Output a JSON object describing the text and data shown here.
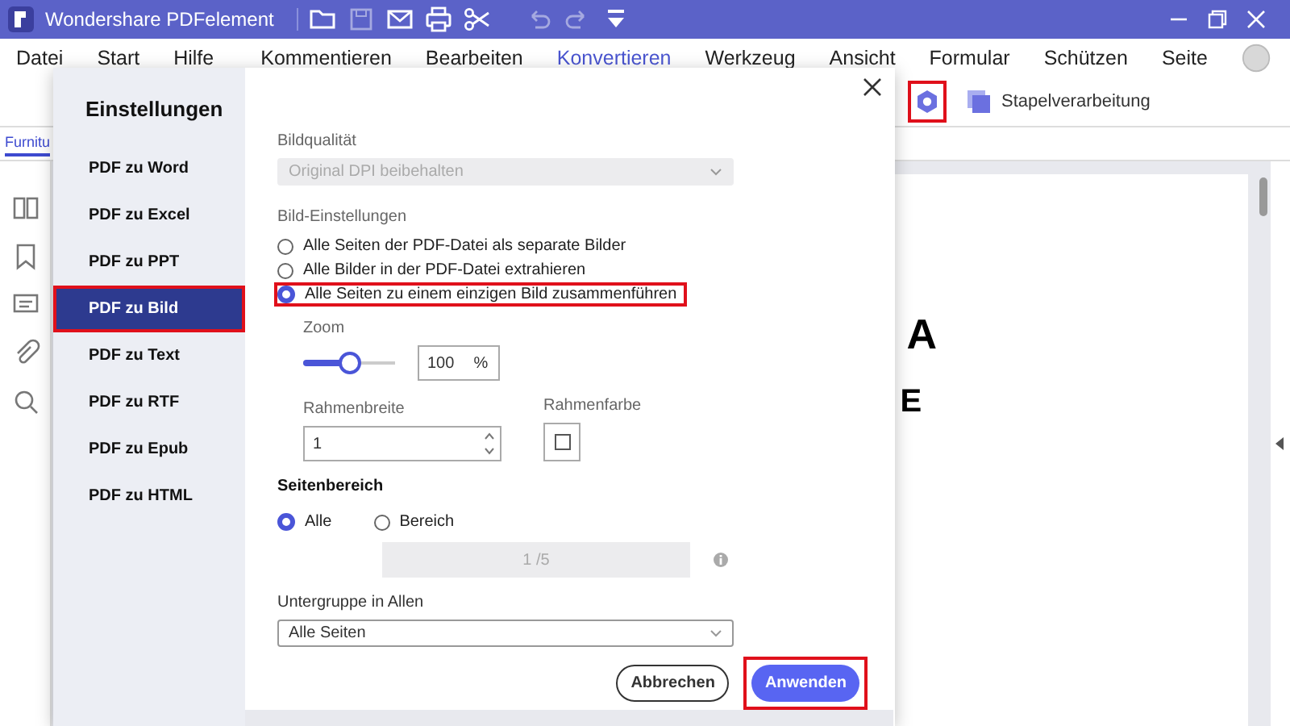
{
  "window": {
    "title": "Wondershare PDFelement"
  },
  "quick_tools": [
    {
      "kind": "folder",
      "disabled": false
    },
    {
      "kind": "save",
      "disabled": true
    },
    {
      "kind": "mail",
      "disabled": false
    },
    {
      "kind": "print",
      "disabled": false
    },
    {
      "kind": "scissors",
      "disabled": false
    },
    {
      "kind": "undo",
      "disabled": true
    },
    {
      "kind": "redo",
      "disabled": true
    },
    {
      "kind": "dropdown",
      "disabled": false
    }
  ],
  "menu": [
    {
      "label": "Datei",
      "selected": false
    },
    {
      "label": "Start",
      "selected": false
    },
    {
      "label": "Hilfe",
      "selected": false
    },
    {
      "label": "Kommentieren",
      "selected": false
    },
    {
      "label": "Bearbeiten",
      "selected": false
    },
    {
      "label": "Konvertieren",
      "selected": true
    },
    {
      "label": "Werkzeug",
      "selected": false
    },
    {
      "label": "Ansicht",
      "selected": false
    },
    {
      "label": "Formular",
      "selected": false
    },
    {
      "label": "Schützen",
      "selected": false
    },
    {
      "label": "Seite",
      "selected": false
    }
  ],
  "toolbar": [
    {
      "kind": "settings",
      "highlighted": true
    },
    {
      "kind": "batch",
      "label": "Stapelverarbeitung",
      "highlighted": false
    }
  ],
  "document": {
    "tab": "Furnitu",
    "texts": [
      "A",
      "E"
    ]
  },
  "dialog": {
    "title": "Einstellungen",
    "sidebar": [
      {
        "label": "PDF zu Word",
        "selected": false,
        "highlighted": false
      },
      {
        "label": "PDF zu Excel",
        "selected": false,
        "highlighted": false
      },
      {
        "label": "PDF zu PPT",
        "selected": false,
        "highlighted": false
      },
      {
        "label": "PDF zu Bild",
        "selected": true,
        "highlighted": true
      },
      {
        "label": "PDF zu Text",
        "selected": false,
        "highlighted": false
      },
      {
        "label": "PDF zu RTF",
        "selected": false,
        "highlighted": false
      },
      {
        "label": "PDF zu Epub",
        "selected": false,
        "highlighted": false
      },
      {
        "label": "PDF zu HTML",
        "selected": false,
        "highlighted": false
      }
    ],
    "image_quality": {
      "label": "Bildqualität",
      "value": "Original DPI beibehalten",
      "disabled": true
    },
    "image_settings": {
      "label": "Bild-Einstellungen",
      "options": [
        {
          "label": "Alle Seiten der PDF-Datei als separate Bilder",
          "selected": false,
          "highlighted": false
        },
        {
          "label": "Alle Bilder in der PDF-Datei extrahieren",
          "selected": false,
          "highlighted": false
        },
        {
          "label": "Alle Seiten zu einem einzigen Bild zusammenführen",
          "selected": true,
          "highlighted": true
        }
      ]
    },
    "zoom": {
      "label": "Zoom",
      "level": 0.49,
      "value": "100",
      "unit": "%"
    },
    "border_width": {
      "label": "Rahmenbreite",
      "value": "1"
    },
    "border_color": {
      "label": "Rahmenfarbe"
    },
    "page_range": {
      "label": "Seitenbereich",
      "options": [
        {
          "label": "Alle",
          "selected": true
        },
        {
          "label": "Bereich",
          "selected": false
        }
      ],
      "range": {
        "value": "1 /5",
        "disabled": true
      }
    },
    "subset": {
      "label": "Untergruppe in Allen",
      "value": "Alle Seiten"
    },
    "buttons": [
      {
        "label": "Abbrechen",
        "kind": "secondary",
        "highlighted": false
      },
      {
        "label": "Anwenden",
        "kind": "primary",
        "highlighted": true
      }
    ]
  }
}
